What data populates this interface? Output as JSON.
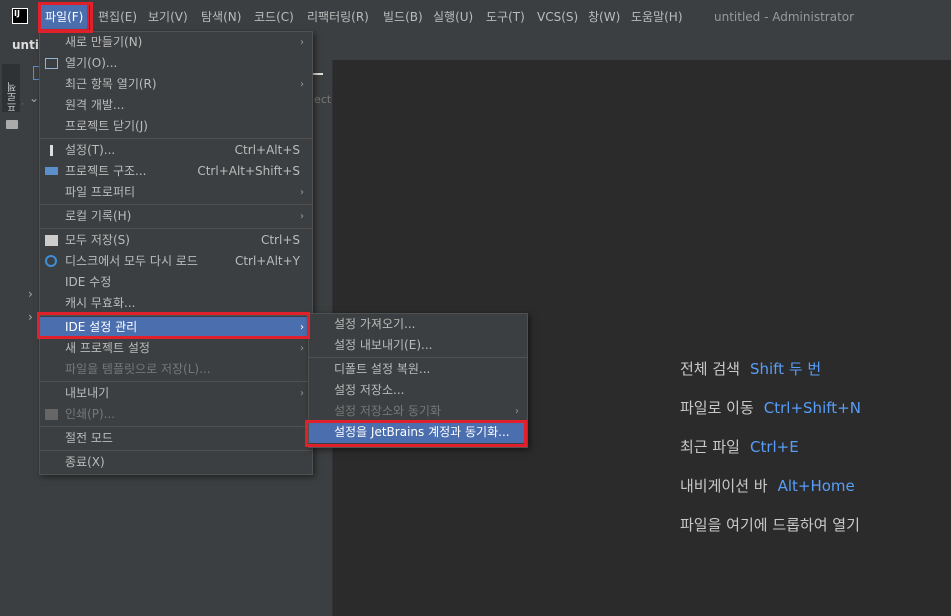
{
  "menubar": {
    "logo": "IJ",
    "items": [
      "파일(F)",
      "편집(E)",
      "보기(V)",
      "탐색(N)",
      "코드(C)",
      "리팩터링(R)",
      "빌드(B)",
      "실행(U)",
      "도구(T)",
      "VCS(S)",
      "창(W)",
      "도움말(H)"
    ],
    "window_title": "untitled - Administrator"
  },
  "tabrow": {
    "project_name": "untit"
  },
  "toolstrip": {
    "project_label": "프로젝트"
  },
  "tree": {
    "ghost": "ject"
  },
  "file_menu": {
    "items": [
      {
        "label": "새로 만들기(N)",
        "shortcut": "",
        "submenu": true,
        "disabled": false,
        "icon": ""
      },
      {
        "label": "열기(O)...",
        "shortcut": "",
        "submenu": false,
        "disabled": false,
        "icon": "folder-icon"
      },
      {
        "label": "최근 항목 열기(R)",
        "shortcut": "",
        "submenu": true,
        "disabled": false,
        "icon": ""
      },
      {
        "label": "원격 개발...",
        "shortcut": "",
        "submenu": false,
        "disabled": false,
        "icon": ""
      },
      {
        "label": "프로젝트 닫기(J)",
        "shortcut": "",
        "submenu": false,
        "disabled": false,
        "icon": ""
      },
      {
        "label": "설정(T)...",
        "shortcut": "Ctrl+Alt+S",
        "submenu": false,
        "disabled": false,
        "icon": "settings-icon"
      },
      {
        "label": "프로젝트 구조...",
        "shortcut": "Ctrl+Alt+Shift+S",
        "submenu": false,
        "disabled": false,
        "icon": "project-structure-icon"
      },
      {
        "label": "파일 프로퍼티",
        "shortcut": "",
        "submenu": true,
        "disabled": false,
        "icon": ""
      },
      {
        "label": "로컬 기록(H)",
        "shortcut": "",
        "submenu": true,
        "disabled": false,
        "icon": ""
      },
      {
        "label": "모두 저장(S)",
        "shortcut": "Ctrl+S",
        "submenu": false,
        "disabled": false,
        "icon": "save-icon"
      },
      {
        "label": "디스크에서 모두 다시 로드",
        "shortcut": "Ctrl+Alt+Y",
        "submenu": false,
        "disabled": false,
        "icon": "reload-icon"
      },
      {
        "label": "IDE 수정",
        "shortcut": "",
        "submenu": false,
        "disabled": false,
        "icon": ""
      },
      {
        "label": "캐시 무효화...",
        "shortcut": "",
        "submenu": false,
        "disabled": false,
        "icon": ""
      },
      {
        "label": "IDE 설정 관리",
        "shortcut": "",
        "submenu": true,
        "disabled": false,
        "icon": "",
        "selected": true
      },
      {
        "label": "새 프로젝트 설정",
        "shortcut": "",
        "submenu": true,
        "disabled": false,
        "icon": ""
      },
      {
        "label": "파일을 템플릿으로 저장(L)...",
        "shortcut": "",
        "submenu": false,
        "disabled": true,
        "icon": ""
      },
      {
        "label": "내보내기",
        "shortcut": "",
        "submenu": true,
        "disabled": false,
        "icon": ""
      },
      {
        "label": "인쇄(P)...",
        "shortcut": "",
        "submenu": false,
        "disabled": true,
        "icon": "print-icon"
      },
      {
        "label": "절전 모드",
        "shortcut": "",
        "submenu": false,
        "disabled": false,
        "icon": ""
      },
      {
        "label": "종료(X)",
        "shortcut": "",
        "submenu": false,
        "disabled": false,
        "icon": ""
      }
    ]
  },
  "settings_submenu": {
    "items": [
      {
        "label": "설정 가져오기...",
        "submenu": false,
        "disabled": false
      },
      {
        "label": "설정 내보내기(E)...",
        "submenu": false,
        "disabled": false
      },
      {
        "label": "디폴트 설정 복원...",
        "submenu": false,
        "disabled": false
      },
      {
        "label": "설정 저장소...",
        "submenu": false,
        "disabled": false
      },
      {
        "label": "설정 저장소와 동기화",
        "submenu": true,
        "disabled": true
      },
      {
        "label": "설정을 JetBrains 계정과 동기화...",
        "submenu": false,
        "disabled": false,
        "selected": true
      }
    ]
  },
  "hints": [
    {
      "label": "전체 검색",
      "value": "Shift 두 번"
    },
    {
      "label": "파일로 이동",
      "value": "Ctrl+Shift+N"
    },
    {
      "label": "최근 파일",
      "value": "Ctrl+E"
    },
    {
      "label": "내비게이션 바",
      "value": "Alt+Home"
    },
    {
      "label": "파일을 여기에 드롭하여 열기",
      "value": ""
    }
  ],
  "colors": {
    "accent": "#4b6eaf",
    "highlight": "#e0202a",
    "link": "#589df6",
    "background": "#2b2b2b",
    "panel": "#3c3f41"
  }
}
